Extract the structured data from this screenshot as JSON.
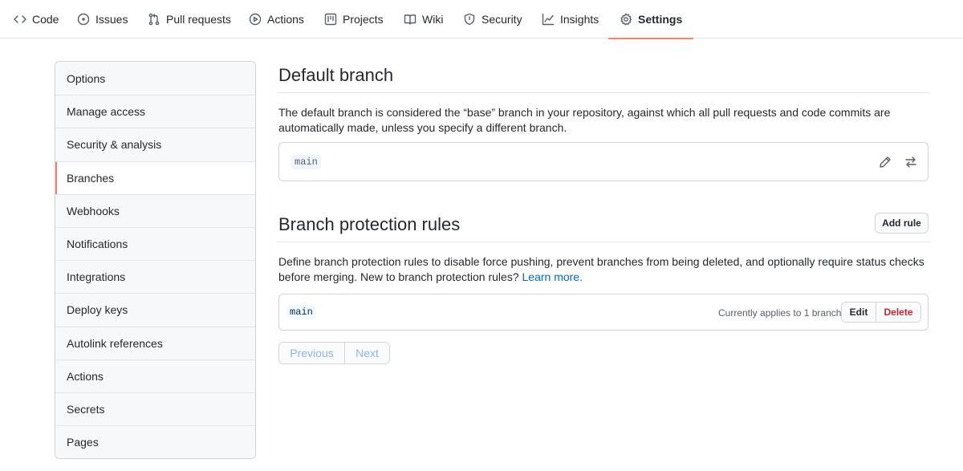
{
  "topnav": {
    "tabs": [
      {
        "label": "Code",
        "icon": "code-icon"
      },
      {
        "label": "Issues",
        "icon": "issue-opened-icon"
      },
      {
        "label": "Pull requests",
        "icon": "git-pull-request-icon"
      },
      {
        "label": "Actions",
        "icon": "play-icon"
      },
      {
        "label": "Projects",
        "icon": "project-icon"
      },
      {
        "label": "Wiki",
        "icon": "book-icon"
      },
      {
        "label": "Security",
        "icon": "shield-icon"
      },
      {
        "label": "Insights",
        "icon": "graph-icon"
      },
      {
        "label": "Settings",
        "icon": "gear-icon",
        "selected": true
      }
    ],
    "accent_color": "#f9826c"
  },
  "sidebar": {
    "items": [
      {
        "label": "Options"
      },
      {
        "label": "Manage access"
      },
      {
        "label": "Security & analysis"
      },
      {
        "label": "Branches",
        "active": true
      },
      {
        "label": "Webhooks"
      },
      {
        "label": "Notifications"
      },
      {
        "label": "Integrations"
      },
      {
        "label": "Deploy keys"
      },
      {
        "label": "Autolink references"
      },
      {
        "label": "Actions"
      },
      {
        "label": "Secrets"
      },
      {
        "label": "Pages"
      }
    ]
  },
  "default_branch": {
    "title": "Default branch",
    "description": "The default branch is considered the “base” branch in your repository, against which all pull requests and code commits are automatically made, unless you specify a different branch.",
    "branch_name": "main",
    "edit_icon": "pencil-icon",
    "switch_icon": "arrow-switch-icon"
  },
  "protection": {
    "title": "Branch protection rules",
    "add_rule_label": "Add rule",
    "description": "Define branch protection rules to disable force pushing, prevent branches from being deleted, and optionally require status checks before merging. New to branch protection rules?",
    "learn_more": "Learn more.",
    "link_color": "#0366d6",
    "rule": {
      "pattern": "main",
      "applies_text": "Currently applies to 1 branch",
      "edit_label": "Edit",
      "delete_label": "Delete",
      "delete_color": "#cb2431"
    },
    "pagination": {
      "previous": "Previous",
      "next": "Next"
    }
  }
}
